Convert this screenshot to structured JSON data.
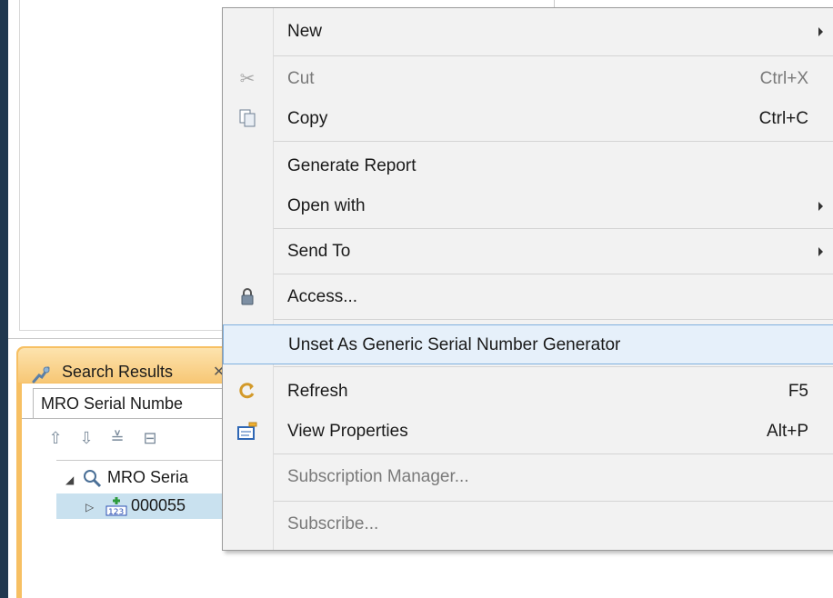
{
  "search_panel": {
    "title": "Search Results",
    "close_glyph": "✕",
    "subtab_label": "MRO Serial Numbe",
    "tree_query_label": "MRO Seria",
    "tree_item_label": "000055"
  },
  "context_menu": {
    "items": [
      {
        "label": "New",
        "submenu": true
      },
      {
        "label": "Cut",
        "shortcut": "Ctrl+X",
        "disabled": true,
        "icon": "scissors-icon"
      },
      {
        "label": "Copy",
        "shortcut": "Ctrl+C",
        "icon": "copy-icon"
      },
      {
        "label": "Generate Report"
      },
      {
        "label": "Open with",
        "submenu": true
      },
      {
        "label": "Send To",
        "submenu": true
      },
      {
        "label": "Access...",
        "icon": "lock-icon"
      },
      {
        "label": "Unset As Generic Serial Number Generator",
        "highlighted": true
      },
      {
        "label": "Refresh",
        "shortcut": "F5",
        "icon": "refresh-icon"
      },
      {
        "label": "View Properties",
        "shortcut": "Alt+P",
        "icon": "properties-icon"
      },
      {
        "label": "Subscription Manager...",
        "disabled": true
      },
      {
        "label": "Subscribe...",
        "disabled": true
      }
    ]
  },
  "colors": {
    "panel_accent": "#f7c063",
    "selection_row": "#c9e1ef",
    "menu_highlight": "#e6f0fa",
    "left_strip": "#20384f"
  }
}
